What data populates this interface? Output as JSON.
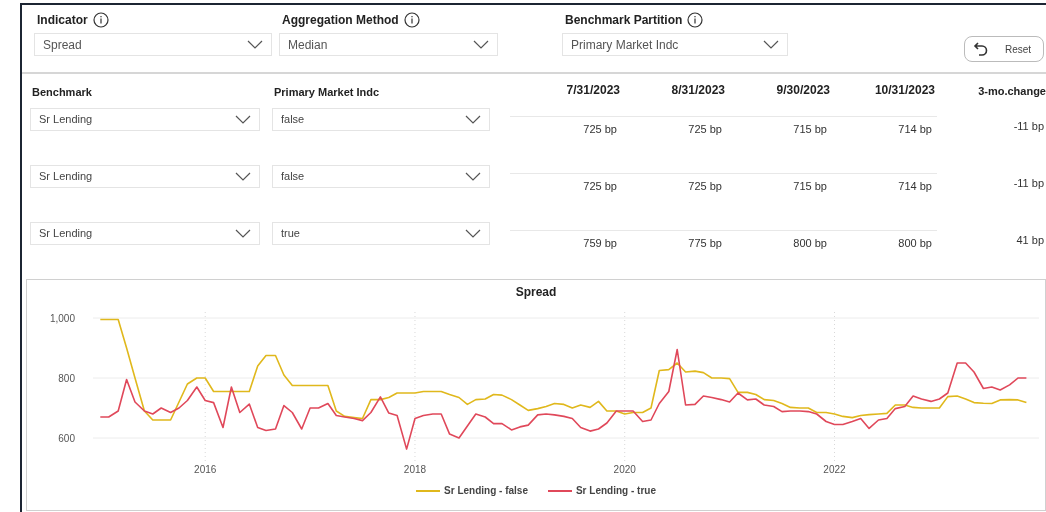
{
  "filters": [
    {
      "label": "Indicator",
      "value": "Spread",
      "info": true
    },
    {
      "label": "Aggregation Method",
      "value": "Median",
      "info": true
    },
    {
      "label": "Benchmark Partition",
      "value": "Primary Market Indc",
      "info": true
    }
  ],
  "reset_button": {
    "label": "Reset"
  },
  "table": {
    "columns": [
      "Benchmark",
      "Primary Market Indc",
      "7/31/2023",
      "8/31/2023",
      "9/30/2023",
      "10/31/2023",
      "3-mo.change"
    ],
    "rows": [
      {
        "benchmark": "Sr Lending",
        "primary_market_indc": "false",
        "values": [
          "725 bp",
          "725 bp",
          "715 bp",
          "714 bp"
        ],
        "change": "-11 bp"
      },
      {
        "benchmark": "Sr Lending",
        "primary_market_indc": "false",
        "values": [
          "725 bp",
          "725 bp",
          "715 bp",
          "714 bp"
        ],
        "change": "-11 bp"
      },
      {
        "benchmark": "Sr Lending",
        "primary_market_indc": "true",
        "values": [
          "759 bp",
          "775 bp",
          "800 bp",
          "800 bp"
        ],
        "change": "41 bp"
      }
    ]
  },
  "chart": {
    "chart_data": {
      "type": "line",
      "title": "Spread",
      "x": [
        2015,
        2015.08,
        2015.17,
        2015.25,
        2015.33,
        2015.42,
        2015.5,
        2015.58,
        2015.67,
        2015.75,
        2015.83,
        2015.92,
        2016,
        2016.08,
        2016.17,
        2016.25,
        2016.33,
        2016.42,
        2016.5,
        2016.58,
        2016.67,
        2016.75,
        2016.83,
        2016.92,
        2017,
        2017.08,
        2017.17,
        2017.25,
        2017.33,
        2017.42,
        2017.5,
        2017.58,
        2017.67,
        2017.75,
        2017.83,
        2017.92,
        2018,
        2018.08,
        2018.17,
        2018.25,
        2018.33,
        2018.42,
        2018.5,
        2018.58,
        2018.67,
        2018.75,
        2018.83,
        2018.92,
        2019,
        2019.08,
        2019.17,
        2019.25,
        2019.33,
        2019.42,
        2019.5,
        2019.58,
        2019.67,
        2019.75,
        2019.83,
        2019.92,
        2020,
        2020.08,
        2020.17,
        2020.25,
        2020.33,
        2020.42,
        2020.5,
        2020.58,
        2020.67,
        2020.75,
        2020.83,
        2020.92,
        2021,
        2021.08,
        2021.17,
        2021.25,
        2021.33,
        2021.42,
        2021.5,
        2021.58,
        2021.67,
        2021.75,
        2021.83,
        2021.92,
        2022,
        2022.08,
        2022.17,
        2022.25,
        2022.33,
        2022.42,
        2022.5,
        2022.58,
        2022.67,
        2022.75,
        2022.83,
        2022.92,
        2023,
        2023.08,
        2023.17,
        2023.25,
        2023.33,
        2023.42,
        2023.5,
        2023.58,
        2023.67,
        2023.75,
        2023.83
      ],
      "series": [
        {
          "name": "Sr Lending - false",
          "color": "#e0b81c",
          "values": [
            995,
            995,
            995,
            900,
            800,
            690,
            660,
            660,
            660,
            720,
            780,
            800,
            800,
            755,
            755,
            755,
            755,
            755,
            840,
            875,
            875,
            810,
            775,
            775,
            775,
            775,
            775,
            690,
            672,
            668,
            665,
            728,
            728,
            735,
            750,
            750,
            750,
            755,
            755,
            755,
            745,
            735,
            712,
            728,
            730,
            745,
            743,
            728,
            710,
            692,
            698,
            705,
            715,
            712,
            700,
            710,
            702,
            722,
            690,
            690,
            680,
            685,
            685,
            700,
            825,
            828,
            850,
            820,
            823,
            818,
            800,
            800,
            798,
            752,
            752,
            745,
            728,
            725,
            715,
            702,
            700,
            700,
            685,
            685,
            680,
            672,
            668,
            675,
            678,
            680,
            682,
            710,
            710,
            702,
            700,
            700,
            700,
            738,
            740,
            730,
            718,
            716,
            715,
            727,
            728,
            727,
            718
          ]
        },
        {
          "name": "Sr Lending - true",
          "color": "#e0485a",
          "values": [
            670,
            670,
            690,
            795,
            720,
            690,
            680,
            700,
            685,
            700,
            725,
            770,
            725,
            718,
            635,
            770,
            685,
            713,
            635,
            625,
            630,
            708,
            685,
            630,
            700,
            700,
            715,
            675,
            670,
            665,
            658,
            685,
            737,
            683,
            675,
            563,
            665,
            675,
            680,
            680,
            613,
            600,
            640,
            680,
            670,
            648,
            648,
            627,
            637,
            643,
            677,
            680,
            677,
            672,
            665,
            635,
            623,
            630,
            650,
            690,
            690,
            690,
            655,
            660,
            715,
            755,
            895,
            710,
            712,
            740,
            735,
            728,
            720,
            750,
            727,
            730,
            710,
            705,
            688,
            690,
            690,
            688,
            680,
            655,
            645,
            645,
            655,
            665,
            632,
            660,
            665,
            698,
            705,
            740,
            730,
            722,
            730,
            750,
            850,
            850,
            820,
            765,
            770,
            760,
            777,
            800,
            800
          ]
        }
      ],
      "grid": true,
      "legend": true,
      "xlim": [
        2014.93,
        2023.95
      ],
      "ylim": [
        520,
        1020
      ],
      "xticks": [
        {
          "value": 2016,
          "label": "2016"
        },
        {
          "value": 2018,
          "label": "2018"
        },
        {
          "value": 2020,
          "label": "2020"
        },
        {
          "value": 2022,
          "label": "2022"
        }
      ],
      "yticks": [
        {
          "value": 600,
          "label": "600"
        },
        {
          "value": 800,
          "label": "800"
        },
        {
          "value": 1000,
          "label": "1,000"
        }
      ]
    }
  }
}
